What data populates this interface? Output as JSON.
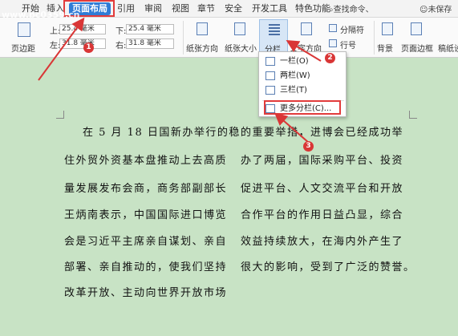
{
  "menubar": {
    "items": [
      "开始",
      "插入",
      "页面布局",
      "引用",
      "审阅",
      "视图",
      "章节",
      "安全",
      "开发工具",
      "特色功能"
    ],
    "search": "查找命令、",
    "unsaved": "未保存"
  },
  "watermark": "www.pc0359.cn",
  "ribbon": {
    "margins_label": "页边距",
    "top_label": "上:",
    "top_value": "25.4 毫米",
    "left_label": "左:",
    "left_value": "31.8 毫米",
    "bottom_label": "下:",
    "bottom_value": "25.4 毫米",
    "right_label": "右:",
    "right_value": "31.8 毫米",
    "orientation_label": "纸张方向",
    "size_label": "纸张大小",
    "columns_label": "分栏",
    "text_direction_label": "文字方向",
    "breaks_label": "分隔符",
    "line_numbers_label": "行号",
    "background_label": "背景",
    "page_border_label": "页面边框",
    "draft_label": "稿纸设"
  },
  "dropdown": {
    "items": [
      "一栏(O)",
      "两栏(W)",
      "三栏(T)",
      "更多分栏(C)..."
    ]
  },
  "badges": [
    "1",
    "2",
    "3"
  ],
  "document": {
    "left_column": [
      "在 5 月 18 日国新办举行的稳",
      "住外贸外资基本盘推动上去高质",
      "量发展发布会商，商务部副部长",
      "王炳南表示，中国国际进口博览",
      "会是习近平主席亲自谋划、亲自",
      "部署、亲自推动的，使我们坚持",
      "改革开放、主动向世界开放市场"
    ],
    "right_column": [
      "的重要举措，进博会已经成功举",
      "办了两届，国际采购平台、投资",
      "促进平台、人文交流平台和开放",
      "合作平台的作用日益凸显，综合",
      "效益持续放大，在海内外产生了",
      "很大的影响，受到了广泛的赞誉。"
    ]
  }
}
